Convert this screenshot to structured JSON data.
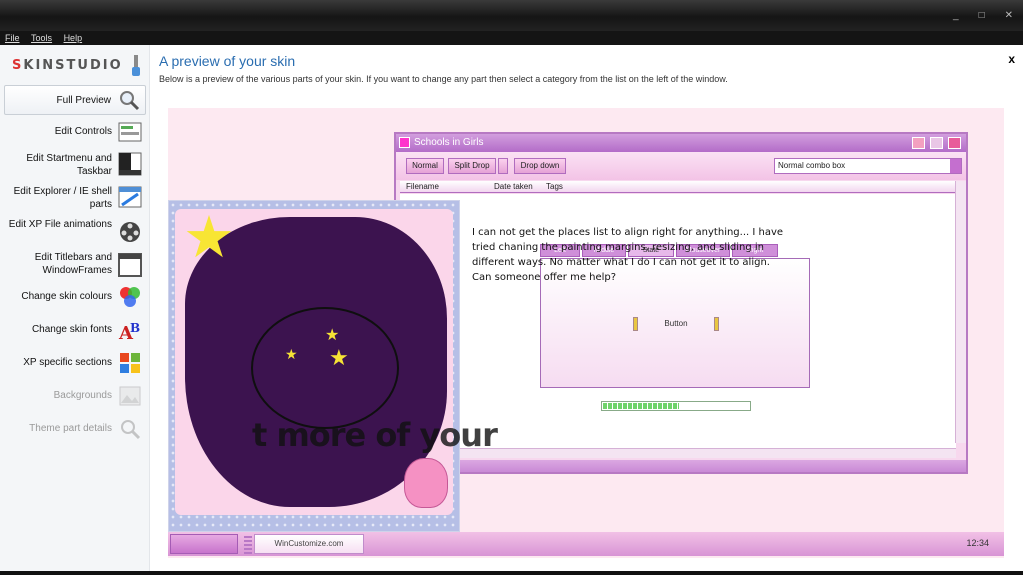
{
  "window": {
    "controls": [
      "_",
      "□",
      "✕"
    ]
  },
  "menubar": {
    "items": [
      "File",
      "Tools",
      "Help"
    ]
  },
  "sidebar": {
    "logo": "SKINSTUDIO",
    "items": [
      {
        "label": "Full Preview",
        "icon": "magnifier-icon",
        "selected": true
      },
      {
        "label": "Edit Controls",
        "icon": "controls-icon"
      },
      {
        "label": "Edit Startmenu and Taskbar",
        "icon": "startmenu-icon"
      },
      {
        "label": "Edit Explorer / IE shell parts",
        "icon": "explorer-icon"
      },
      {
        "label": "Edit XP File animations",
        "icon": "film-reel-icon"
      },
      {
        "label": "Edit Titlebars and WindowFrames",
        "icon": "window-frame-icon"
      },
      {
        "label": "Change skin colours",
        "icon": "color-circles-icon"
      },
      {
        "label": "Change skin fonts",
        "icon": "font-icon"
      },
      {
        "label": "XP specific sections",
        "icon": "windows-flag-icon"
      },
      {
        "label": "Backgrounds",
        "icon": "backgrounds-icon",
        "disabled": true
      },
      {
        "label": "Theme part details",
        "icon": "magnifier-icon",
        "disabled": true
      }
    ]
  },
  "main": {
    "close": "x",
    "title": "A preview of your skin",
    "description": "Below is a preview of the various parts of your skin.  If you want to change any part then select a category from the list on the left of the window."
  },
  "preview": {
    "window_title": "Schools in Girls",
    "buttons": {
      "normal": "Normal",
      "split_drop": "Split Drop",
      "drop_down": "Drop down"
    },
    "combo": "Normal combo box",
    "columns": [
      "Filename",
      "Date taken",
      "Tags"
    ],
    "tabs": [
      "Left",
      "Middle",
      "State",
      "Mouseover",
      "Right"
    ],
    "inner_button": "Button",
    "progress": 0.52,
    "overlay_text": "I can not get the places list to align right for anything... I have tried chaning the painting margins, resizing, and sliding in different ways. No matter what I do I can not get it to align. Can someone offer me help?",
    "watermark": "t more of your",
    "taskbar": {
      "item": "WinCustomize.com",
      "clock": "12:34"
    }
  },
  "colors": {
    "accent": "#2a6db0",
    "skin_primary": "#c46fcf",
    "wallpaper_blob": "#3c134f"
  }
}
